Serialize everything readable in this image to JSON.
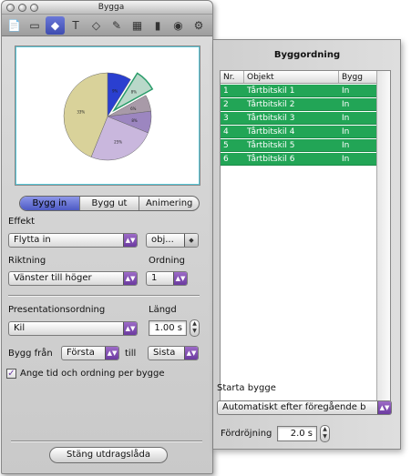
{
  "window": {
    "title": "Bygga"
  },
  "toolbar": {
    "tools": [
      {
        "name": "document-icon",
        "glyph": "📄",
        "active": false
      },
      {
        "name": "slide-icon",
        "glyph": "▭",
        "active": false
      },
      {
        "name": "build-icon",
        "glyph": "◆",
        "active": true
      },
      {
        "name": "text-icon",
        "glyph": "T",
        "active": false
      },
      {
        "name": "graphic-icon",
        "glyph": "◇",
        "active": false
      },
      {
        "name": "metrics-icon",
        "glyph": "✎",
        "active": false
      },
      {
        "name": "table-icon",
        "glyph": "▦",
        "active": false
      },
      {
        "name": "chart-icon",
        "glyph": "▮",
        "active": false
      },
      {
        "name": "media-icon",
        "glyph": "◉",
        "active": false
      },
      {
        "name": "settings-icon",
        "glyph": "⚙",
        "active": false
      }
    ]
  },
  "preview": {
    "pie_labels": [
      "9%",
      "8%",
      "6%",
      "8%",
      "25%",
      "33%"
    ],
    "colors": [
      "#2a3fd0",
      "#b9d8c9",
      "#a89aa8",
      "#9c86c0",
      "#c9b7dd",
      "#d9d29a"
    ]
  },
  "tabs": [
    {
      "label": "Bygg in",
      "selected": true
    },
    {
      "label": "Bygg ut",
      "selected": false
    },
    {
      "label": "Animering",
      "selected": false
    }
  ],
  "effect": {
    "label": "Effekt",
    "value": "Flytta in",
    "object_value": "obj..."
  },
  "direction": {
    "label": "Riktning",
    "value": "Vänster till höger"
  },
  "order": {
    "label": "Ordning",
    "value": "1"
  },
  "presentation": {
    "label": "Presentationsordning",
    "value": "Kil"
  },
  "duration": {
    "label": "Längd",
    "value": "1.00 s"
  },
  "build_from": {
    "label": "Bygg från",
    "from_value": "Första",
    "to_label": "till",
    "to_value": "Sista"
  },
  "per_build": {
    "label": "Ange tid och ordning per bygge",
    "checked": true
  },
  "close_button": {
    "label": "Stäng utdragslåda"
  },
  "drawer": {
    "title": "Byggordning",
    "columns": [
      "Nr.",
      "Objekt",
      "Bygg"
    ],
    "rows": [
      {
        "nr": "1",
        "object": "Tårtbitskil 1",
        "build": "In"
      },
      {
        "nr": "2",
        "object": "Tårtbitskil 2",
        "build": "In"
      },
      {
        "nr": "3",
        "object": "Tårtbitskil 3",
        "build": "In"
      },
      {
        "nr": "4",
        "object": "Tårtbitskil 4",
        "build": "In"
      },
      {
        "nr": "5",
        "object": "Tårtbitskil 5",
        "build": "In"
      },
      {
        "nr": "6",
        "object": "Tårtbitskil 6",
        "build": "In"
      }
    ],
    "start_label": "Starta bygge",
    "start_value": "Automatiskt efter föregående b",
    "delay_label": "Fördröjning",
    "delay_value": "2.0 s"
  }
}
